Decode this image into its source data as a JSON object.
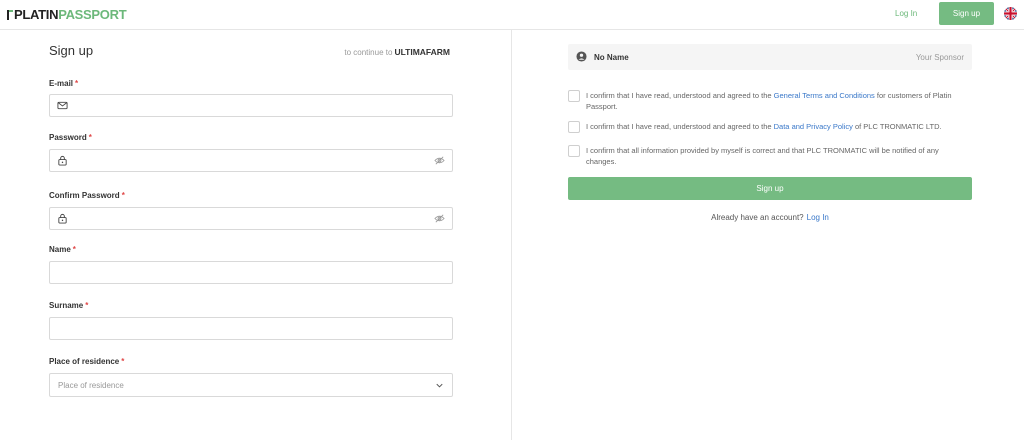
{
  "header": {
    "logo_part1": "PLATIN",
    "logo_part2": "PASSPORT",
    "login_label": "Log In",
    "signup_label": "Sign up",
    "language_icon": "uk-flag-icon"
  },
  "form": {
    "title": "Sign up",
    "continue_prefix": "to continue to",
    "app_name": "ULTIMAFARM",
    "required_mark": "*",
    "email": {
      "label": "E-mail",
      "value": "",
      "icon": "mail-icon"
    },
    "password": {
      "label": "Password",
      "value": "",
      "icon": "lock-icon",
      "toggle_icon": "eye-off-icon"
    },
    "confirm_password": {
      "label": "Confirm Password",
      "value": "",
      "icon": "lock-icon",
      "toggle_icon": "eye-off-icon"
    },
    "name": {
      "label": "Name",
      "value": ""
    },
    "surname": {
      "label": "Surname",
      "value": ""
    },
    "residence": {
      "label": "Place of residence",
      "placeholder": "Place of residence"
    }
  },
  "sponsor": {
    "name": "No Name",
    "role": "Your Sponsor"
  },
  "agreements": [
    {
      "text_before": "I confirm that I have read, understood and agreed to the",
      "link": "General Terms and Conditions",
      "text_after": "for customers of Platin Passport."
    },
    {
      "text_before": "I confirm that I have read, understood and agreed to the",
      "link": "Data and Privacy Policy",
      "text_after": "of PLC TRONMATIC LTD."
    },
    {
      "text_before": "I confirm that all information provided by myself is correct and that PLC TRONMATIC will be notified of any changes.",
      "link": "",
      "text_after": ""
    }
  ],
  "submit_label": "Sign up",
  "footer": {
    "question": "Already have an account?",
    "login_link": "Log In"
  },
  "colors": {
    "accent": "#75bb82",
    "link": "#3a78c9",
    "required": "#e04848"
  }
}
